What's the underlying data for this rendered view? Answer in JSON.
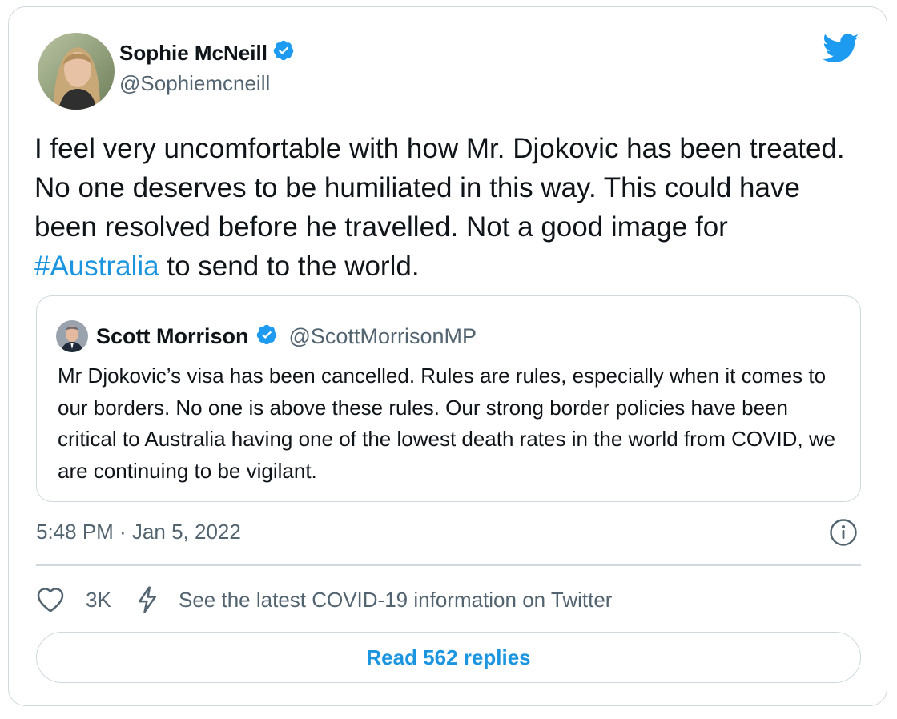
{
  "tweet": {
    "author": {
      "name": "Sophie McNeill",
      "handle": "@Sophiemcneill",
      "verified": true
    },
    "text_before_hashtag": "I feel very uncomfortable with how Mr. Djokovic has been treated. No one deserves to be humiliated in this way. This could have been resolved before he travelled. Not a good image for ",
    "hashtag": "#Australia",
    "text_after_hashtag": " to send to the world.",
    "timestamp": "5:48 PM · Jan 5, 2022"
  },
  "quoted_tweet": {
    "author": {
      "name": "Scott Morrison",
      "handle": "@ScottMorrisonMP",
      "verified": true
    },
    "text": "Mr Djokovic’s visa has been cancelled. Rules are rules, especially when it comes to our borders. No one is above these rules. Our strong border policies have been critical to Australia having one of the lowest death rates in the world from COVID, we are continuing to be vigilant."
  },
  "actions": {
    "like_count": "3K",
    "covid_info_label": "See the latest COVID-19 information on Twitter",
    "read_replies_label": "Read 562 replies"
  },
  "icons": {
    "brand": "twitter-bird-icon",
    "verified": "verified-badge-icon",
    "info": "info-icon",
    "like": "heart-icon",
    "covid": "lightning-bolt-icon"
  },
  "colors": {
    "brand_blue": "#1d9bf0",
    "link_blue": "#1b95e0",
    "text_primary": "#0f1419",
    "text_secondary": "#536471",
    "border": "#cfd9de"
  }
}
